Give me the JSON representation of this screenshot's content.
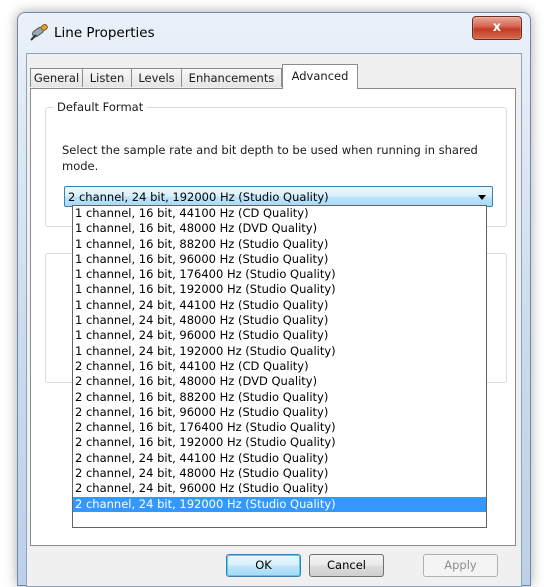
{
  "window": {
    "title": "Line Properties",
    "icon": "microphone-icon",
    "close_glyph": "x"
  },
  "tabs": [
    "General",
    "Listen",
    "Levels",
    "Enhancements",
    "Advanced"
  ],
  "active_tab": "Advanced",
  "default_format": {
    "group_title": "Default Format",
    "description": "Select the sample rate and bit depth to be used when running in shared mode.",
    "selected": "2 channel, 24 bit, 192000 Hz (Studio Quality)",
    "options": [
      "1 channel, 16 bit, 44100 Hz (CD Quality)",
      "1 channel, 16 bit, 48000 Hz (DVD Quality)",
      "1 channel, 16 bit, 88200 Hz (Studio Quality)",
      "1 channel, 16 bit, 96000 Hz (Studio Quality)",
      "1 channel, 16 bit, 176400 Hz (Studio Quality)",
      "1 channel, 16 bit, 192000 Hz (Studio Quality)",
      "1 channel, 24 bit, 44100 Hz (Studio Quality)",
      "1 channel, 24 bit, 48000 Hz (Studio Quality)",
      "1 channel, 24 bit, 96000 Hz (Studio Quality)",
      "1 channel, 24 bit, 192000 Hz (Studio Quality)",
      "2 channel, 16 bit, 44100 Hz (CD Quality)",
      "2 channel, 16 bit, 48000 Hz (DVD Quality)",
      "2 channel, 16 bit, 88200 Hz (Studio Quality)",
      "2 channel, 16 bit, 96000 Hz (Studio Quality)",
      "2 channel, 16 bit, 176400 Hz (Studio Quality)",
      "2 channel, 16 bit, 192000 Hz (Studio Quality)",
      "2 channel, 24 bit, 44100 Hz (Studio Quality)",
      "2 channel, 24 bit, 48000 Hz (Studio Quality)",
      "2 channel, 24 bit, 96000 Hz (Studio Quality)",
      "2 channel, 24 bit, 192000 Hz (Studio Quality)"
    ],
    "highlighted_index": 19
  },
  "partially_hidden_group_glyph": "E",
  "buttons": {
    "ok": "OK",
    "cancel": "Cancel",
    "apply": "Apply"
  },
  "colors": {
    "selection": "#3399ff",
    "close_button": "#c13b22"
  }
}
